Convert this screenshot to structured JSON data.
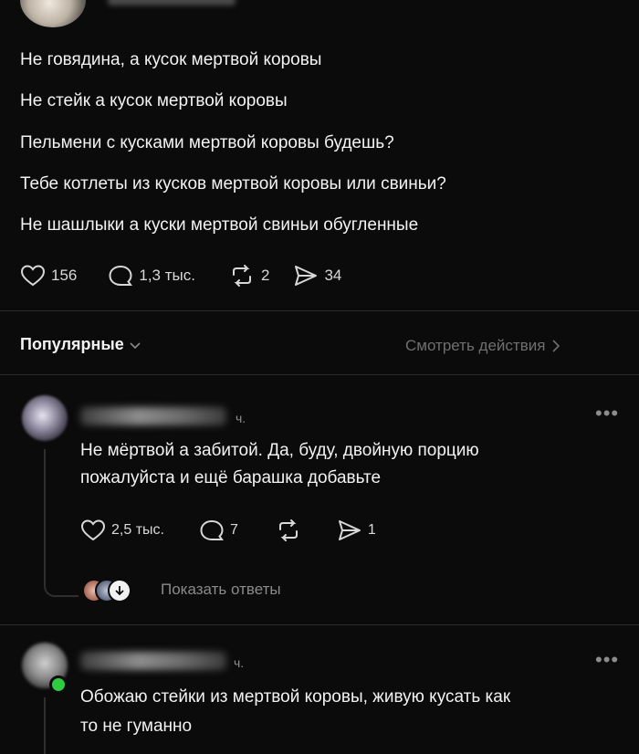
{
  "post": {
    "lines": [
      "Не говядина, а кусок мертвой коровы",
      "Не стейк а кусок мертвой коровы",
      "Пельмени с кусками мертвой коровы будешь?",
      "Тебе котлеты из кусков мертвой коровы или свиньи?",
      "Не шашлыки а куски мертвой свиньи обугленные"
    ],
    "likes": "156",
    "comments": "1,3 тыс.",
    "reposts": "2",
    "shares": "34"
  },
  "sort": {
    "label": "Популярные",
    "see_actions": "Смотреть действия"
  },
  "comments": [
    {
      "time": "ч.",
      "text_lines": [
        "Не мёртвой а забитой. Да, буду, двойную порцию",
        "пожалуйста и ещё  барашка добавьте"
      ],
      "likes": "2,5 тыс.",
      "comments": "7",
      "shares": "1",
      "show_replies": "Показать ответы"
    },
    {
      "time": "ч.",
      "text_lines": [
        "Обожаю стейки из мертвой коровы, живую кусать как",
        "то не гуманно"
      ]
    }
  ],
  "colors": {
    "bg": "#0b0b0b",
    "text": "#f2f2f2",
    "muted": "#8a8a8a",
    "online": "#2ecc40"
  }
}
